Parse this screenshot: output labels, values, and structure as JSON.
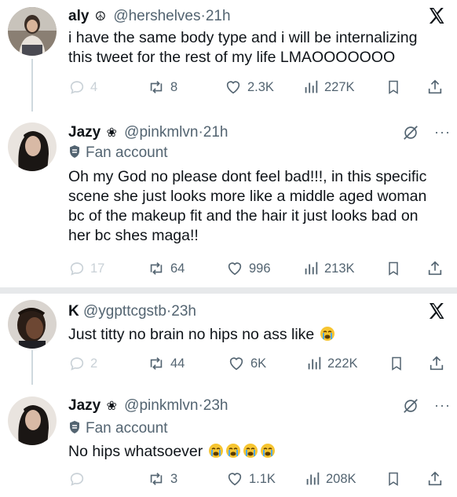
{
  "tweets": [
    {
      "name": "aly",
      "badge": "☮",
      "handle": "@hershelves",
      "sep": "·",
      "time": "21h",
      "text": "i have the same body type and i will be internalizing this tweet for the rest of my life LMAOOOOOOO",
      "corner_icon": "x-logo-icon",
      "actions": {
        "replies": "4",
        "reposts": "8",
        "likes": "2.3K",
        "views": "227K"
      }
    },
    {
      "name": "Jazy",
      "badge": "❀",
      "handle": "@pinkmlvn",
      "sep": "·",
      "time": "21h",
      "label": "Fan account",
      "text": "Oh my God no please dont feel bad!!!, in this specific scene she just looks more like a middle aged woman bc of the makeup fit and the hair it just looks bad on her bc shes maga!!",
      "corner_icon": "grok-slash-icon",
      "more": "···",
      "actions": {
        "replies": "17",
        "reposts": "64",
        "likes": "996",
        "views": "213K"
      }
    },
    {
      "name": "K",
      "handle": "@ygpttcgstb",
      "sep": "·",
      "time": "23h",
      "text": "Just titty no brain no hips no ass like",
      "corner_icon": "x-logo-icon",
      "actions": {
        "replies": "2",
        "reposts": "44",
        "likes": "6K",
        "views": "222K"
      }
    },
    {
      "name": "Jazy",
      "badge": "❀",
      "handle": "@pinkmlvn",
      "sep": "·",
      "time": "23h",
      "label": "Fan account",
      "text": "No hips whatsoever",
      "corner_icon": "grok-slash-icon",
      "more": "···",
      "actions": {
        "replies": "",
        "reposts": "3",
        "likes": "1.1K",
        "views": "208K"
      }
    }
  ],
  "colors": {
    "text": "#0f1419",
    "muted": "#536471",
    "faint": "#c9d1d7",
    "divider": "#e7e9eb",
    "emoji": "#f7c531"
  }
}
